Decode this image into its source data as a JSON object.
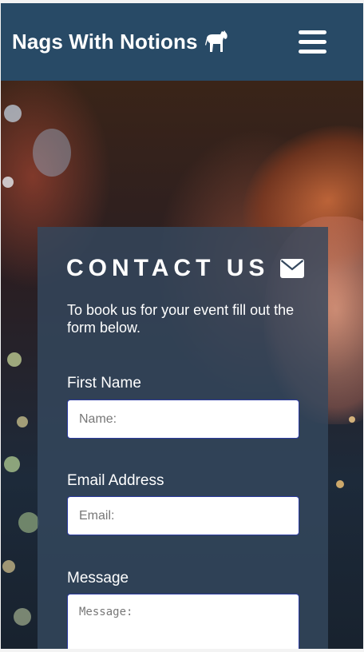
{
  "header": {
    "brand_title": "Nags With Notions",
    "brand_icon": "horse-icon",
    "menu_icon": "hamburger-menu-icon",
    "background_color": "#284a66"
  },
  "contact_card": {
    "title": "CONTACT US",
    "title_icon": "envelope-icon",
    "intro": "To book us for your event fill out the form below.",
    "fields": {
      "first_name": {
        "label": "First Name",
        "placeholder": "Name:"
      },
      "email": {
        "label": "Email Address",
        "placeholder": "Email:"
      },
      "message": {
        "label": "Message",
        "placeholder": "Message:"
      }
    }
  }
}
